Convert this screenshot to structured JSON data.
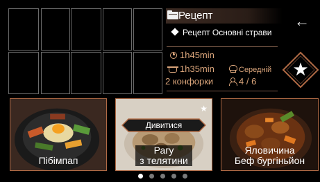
{
  "header": {
    "title": "Рецепт",
    "icon": "folder-icon"
  },
  "back": {
    "glyph": "←",
    "icon": "back-arrow-icon"
  },
  "breadcrumb": {
    "text": "Рецепт Основні страви"
  },
  "info": {
    "total_time": "1h45min",
    "cook_time": "1h35min",
    "difficulty": "Середній",
    "burners": "2 конфорки",
    "servings": "4 / 6"
  },
  "favorite": {
    "icon": "star-icon",
    "glyph": "★"
  },
  "cards": [
    {
      "label": "Пібімпап"
    },
    {
      "label_line1": "Рагу",
      "label_line2": "з телятини",
      "button": "Дивитися",
      "star": "★"
    },
    {
      "label_line1": "Яловичина",
      "label_line2": "Беф бургіньйон"
    }
  ],
  "pager": {
    "count": 5,
    "active": 1
  },
  "colors": {
    "accent": "#d9a47a",
    "border": "#b06a45",
    "background": "#000000"
  }
}
